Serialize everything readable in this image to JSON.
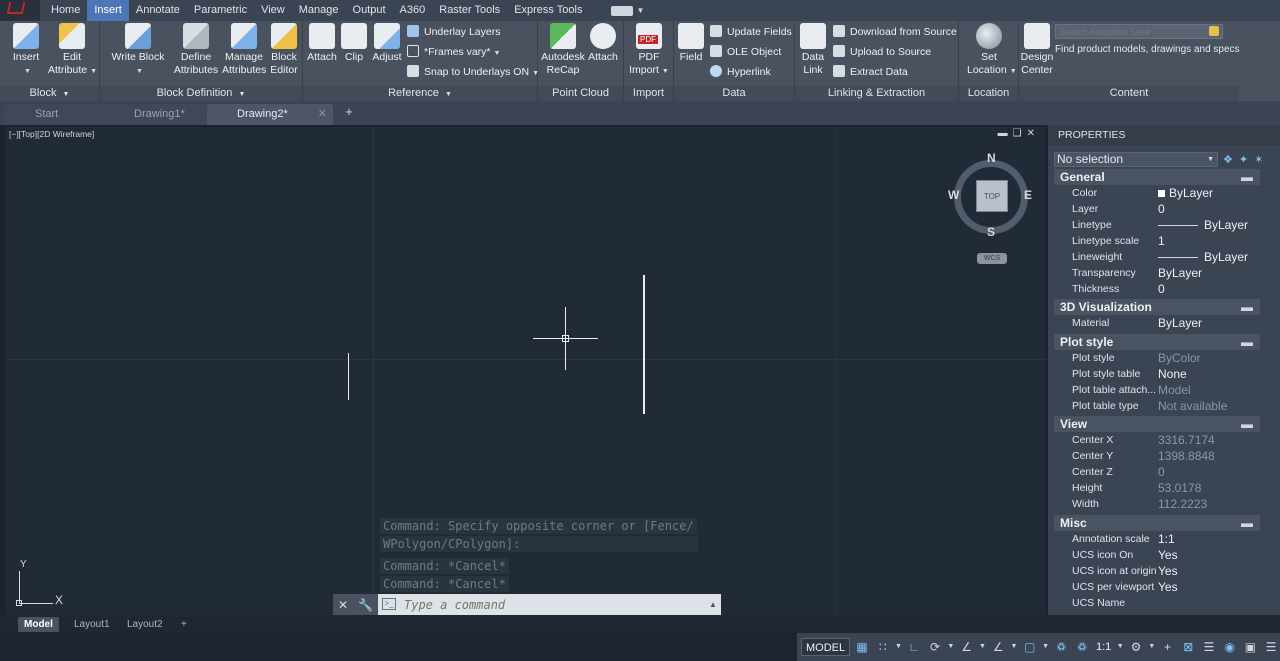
{
  "ribbon_tabs": [
    "Home",
    "Insert",
    "Annotate",
    "Parametric",
    "View",
    "Manage",
    "Output",
    "A360",
    "Raster Tools",
    "Express Tools"
  ],
  "active_tab": "Insert",
  "panels": {
    "block": {
      "title": "Block",
      "insert": "Insert",
      "edit_attribute_1": "Edit",
      "edit_attribute_2": "Attribute"
    },
    "block_definition": {
      "title": "Block Definition",
      "write_block": "Write Block",
      "define_1": "Define",
      "define_2": "Attributes",
      "manage_1": "Manage",
      "manage_2": "Attributes",
      "editor_1": "Block",
      "editor_2": "Editor"
    },
    "reference": {
      "title": "Reference",
      "attach": "Attach",
      "clip": "Clip",
      "adjust": "Adjust",
      "underlay_layers": "Underlay Layers",
      "frames_vary": "*Frames vary*",
      "snap_underlays": "Snap to Underlays ON"
    },
    "point_cloud": {
      "title": "Point Cloud",
      "recap_1": "Autodesk",
      "recap_2": "ReCap",
      "attach": "Attach"
    },
    "import": {
      "title": "Import",
      "pdf_1": "PDF",
      "pdf_2": "Import",
      "pdf_badge": "PDF"
    },
    "data": {
      "title": "Data",
      "field": "Field",
      "update_fields": "Update Fields",
      "ole_object": "OLE Object",
      "hyperlink": "Hyperlink"
    },
    "linking": {
      "title": "Linking & Extraction",
      "data_link_1": "Data",
      "data_link_2": "Link",
      "download": "Download from Source",
      "upload": "Upload to Source",
      "extract": "Extract  Data"
    },
    "location": {
      "title": "Location",
      "set_1": "Set",
      "set_2": "Location"
    },
    "content": {
      "title": "Content",
      "design_1": "Design",
      "design_2": "Center",
      "search_placeholder": "Search Autodesk Seek",
      "seek_text": "Find product models, drawings and specs"
    }
  },
  "file_tabs": [
    {
      "label": "Start"
    },
    {
      "label": "Drawing1*"
    },
    {
      "label": "Drawing2*"
    }
  ],
  "viewport": {
    "label": "[−][Top][2D Wireframe]",
    "viewcube": {
      "top": "TOP",
      "n": "N",
      "s": "S",
      "e": "E",
      "w": "W",
      "wcs": "WCS"
    }
  },
  "command": {
    "history": [
      "Command: Specify opposite corner or [Fence/",
      "WPolygon/CPolygon]:",
      "Command: *Cancel*",
      "Command: *Cancel*"
    ],
    "placeholder": "Type a command"
  },
  "ucs": {
    "x": "X",
    "y": "Y"
  },
  "properties": {
    "title": "PROPERTIES",
    "selection": "No selection",
    "sections": {
      "general": {
        "title": "General",
        "rows": [
          {
            "name": "Color",
            "value": "ByLayer"
          },
          {
            "name": "Layer",
            "value": "0"
          },
          {
            "name": "Linetype",
            "value": "ByLayer"
          },
          {
            "name": "Linetype scale",
            "value": "1"
          },
          {
            "name": "Lineweight",
            "value": "ByLayer"
          },
          {
            "name": "Transparency",
            "value": "ByLayer"
          },
          {
            "name": "Thickness",
            "value": "0"
          }
        ]
      },
      "viz": {
        "title": "3D Visualization",
        "rows": [
          {
            "name": "Material",
            "value": "ByLayer"
          }
        ]
      },
      "plot": {
        "title": "Plot style",
        "rows": [
          {
            "name": "Plot style",
            "value": "ByColor"
          },
          {
            "name": "Plot style table",
            "value": "None"
          },
          {
            "name": "Plot table attach...",
            "value": "Model"
          },
          {
            "name": "Plot table type",
            "value": "Not available"
          }
        ]
      },
      "view": {
        "title": "View",
        "rows": [
          {
            "name": "Center X",
            "value": "3316.7174"
          },
          {
            "name": "Center Y",
            "value": "1398.8848"
          },
          {
            "name": "Center Z",
            "value": "0"
          },
          {
            "name": "Height",
            "value": "53.0178"
          },
          {
            "name": "Width",
            "value": "112.2223"
          }
        ]
      },
      "misc": {
        "title": "Misc",
        "rows": [
          {
            "name": "Annotation scale",
            "value": "1:1"
          },
          {
            "name": "UCS icon On",
            "value": "Yes"
          },
          {
            "name": "UCS icon at origin",
            "value": "Yes"
          },
          {
            "name": "UCS per viewport",
            "value": "Yes"
          },
          {
            "name": "UCS Name",
            "value": ""
          }
        ]
      }
    }
  },
  "layout_tabs": [
    "Model",
    "Layout1",
    "Layout2"
  ],
  "status": {
    "model": "MODEL",
    "scale": "1:1"
  }
}
